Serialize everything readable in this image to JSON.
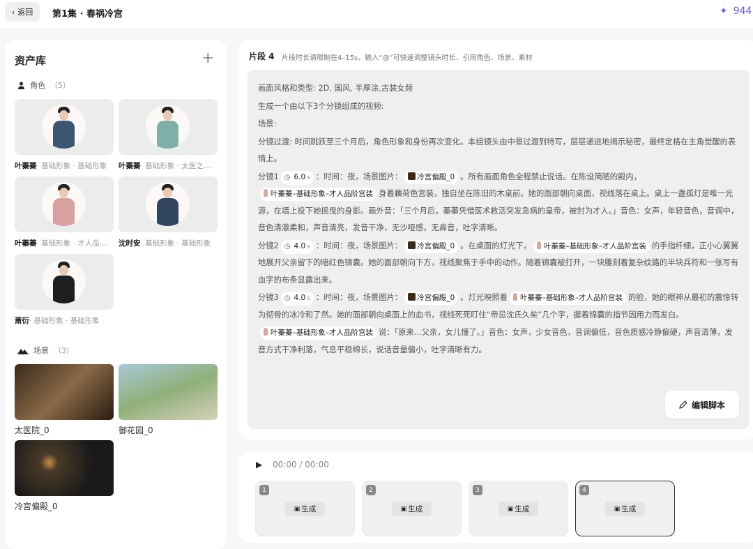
{
  "header": {
    "back_label": "返回",
    "episode_title": "第1集 · 春祸冷宫",
    "credits": "944",
    "accent": "#6c5ce7"
  },
  "library": {
    "title": "资产库",
    "characters_label": "角色",
    "characters_count": "（5）",
    "characters": [
      {
        "name": "叶蓁蓁",
        "desc": "· 基础形象 · 基础形象",
        "color": "#3b5770"
      },
      {
        "name": "叶蓁蓁",
        "desc": "· 基础形象 · 太医之…",
        "color": "#7fb0a8"
      },
      {
        "name": "叶蓁蓁",
        "desc": "· 基础形象 · 才人品…",
        "color": "#d9a0a0"
      },
      {
        "name": "沈时安",
        "desc": "· 基础形象 · 基础形象",
        "color": "#2f4560"
      },
      {
        "name": "萧衍",
        "desc": "· 基础形象 · 基础形象",
        "color": "#1e1e1e"
      }
    ],
    "scenes_label": "场景",
    "scenes_count": "（3）",
    "scenes": [
      {
        "name": "太医院_0",
        "bg": "linear-gradient(135deg,#3a2a1c,#8a6a48 50%,#2a1c10)"
      },
      {
        "name": "御花园_0",
        "bg": "linear-gradient(160deg,#a9c9d8,#8fb07a 50%,#d6d0b8)"
      },
      {
        "name": "冷宫偏殿_0",
        "bg": "radial-gradient(circle at 35% 40%,#c89040 0,#4a3a28 12%,#1a1a1a 60%)"
      }
    ]
  },
  "segment": {
    "title": "片段 4",
    "hint": "片段时长请限制在4–15s，输入“@”可快速调整镜头时长、引用角色、场景、素材",
    "paragraphs": [
      [
        {
          "t": "text",
          "v": "画面风格和类型: 2D, 国风, 半厚涂,古装女频"
        }
      ],
      [
        {
          "t": "text",
          "v": "生成一个由以下3个分镜组成的视频:"
        }
      ],
      [
        {
          "t": "text",
          "v": "场景:"
        }
      ],
      [
        {
          "t": "text",
          "v": "分镜过渡: 时间跳跃至三个月后，角色形象和身份再次变化。本组镜头由中景过渡到特写，层层递进地揭示秘密，最终定格在主角觉醒的表情上。"
        }
      ],
      [
        {
          "t": "text",
          "v": "分镜1"
        },
        {
          "t": "time",
          "v": "6.0",
          "u": "s"
        },
        {
          "t": "text",
          "v": "：时间：夜，场景图片："
        },
        {
          "t": "scene",
          "v": "冷宫偏殿_0"
        },
        {
          "t": "text",
          "v": "。所有画面角色全程禁止说话。在陈设简陋的殿内，"
        },
        {
          "t": "char",
          "v": "叶蓁蓁–基础形象–才人品阶宫装"
        },
        {
          "t": "text",
          "v": "身着藕荷色宫装，独自坐在陈旧的木桌前。她的面部朝向桌面，视线落在桌上。桌上一盏孤灯是唯一光源，在墙上投下她摇曳的身影。画外音：「三个月后，蓁蓁凭借医术救活突发急病的皇帝，被封为才人。」音色：女声，年轻音色，音调中，音色清澈柔和，声音清亮，发音干净，无沙哑感，无鼻音，吐字清晰。"
        }
      ],
      [
        {
          "t": "text",
          "v": "分镜2"
        },
        {
          "t": "time",
          "v": "4.0",
          "u": "s"
        },
        {
          "t": "text",
          "v": "：时间：夜，场景图片："
        },
        {
          "t": "scene",
          "v": "冷宫偏殿_0"
        },
        {
          "t": "text",
          "v": "。在桌面的灯光下，"
        },
        {
          "t": "char",
          "v": "叶蓁蓁–基础形象–才人品阶宫装"
        },
        {
          "t": "text",
          "v": "的手指纤细，正小心翼翼地展开父亲留下的暗红色锦囊。她的面部朝向下方，视线聚焦于手中的动作。随着锦囊被打开，一块雕刻着复杂纹路的半块兵符和一张写有血字的布条显露出来。"
        }
      ],
      [
        {
          "t": "text",
          "v": "分镜3"
        },
        {
          "t": "time",
          "v": "4.0",
          "u": "s"
        },
        {
          "t": "text",
          "v": "：时间：夜，场景图片："
        },
        {
          "t": "scene",
          "v": "冷宫偏殿_0"
        },
        {
          "t": "text",
          "v": "。灯光映照着"
        },
        {
          "t": "char",
          "v": "叶蓁蓁–基础形象–才人品阶宫装"
        },
        {
          "t": "text",
          "v": "的脸，她的眼神从最初的震惊转为彻骨的冰冷和了然。她的面部朝向桌面上的血书，视线死死盯住“帝忌沈氏久矣”几个字，握着锦囊的指节因用力而发白。"
        }
      ],
      [
        {
          "t": "char",
          "v": "叶蓁蓁–基础形象–才人品阶宫装"
        },
        {
          "t": "text",
          "v": "说：「原来...父亲，女儿懂了。」音色：女声，少女音色，音调偏低，音色质感冷静偏硬，声音清薄，发音方式干净利落，气息平稳绵长，说话音量偏小，吐字清晰有力。"
        }
      ]
    ],
    "edit_label": "编辑脚本"
  },
  "player": {
    "time": "00:00 / 00:00",
    "shots": [
      {
        "num": "1",
        "label": "生成"
      },
      {
        "num": "2",
        "label": "生成"
      },
      {
        "num": "3",
        "label": "生成"
      },
      {
        "num": "4",
        "label": "生成"
      }
    ],
    "active_shot": "4"
  }
}
